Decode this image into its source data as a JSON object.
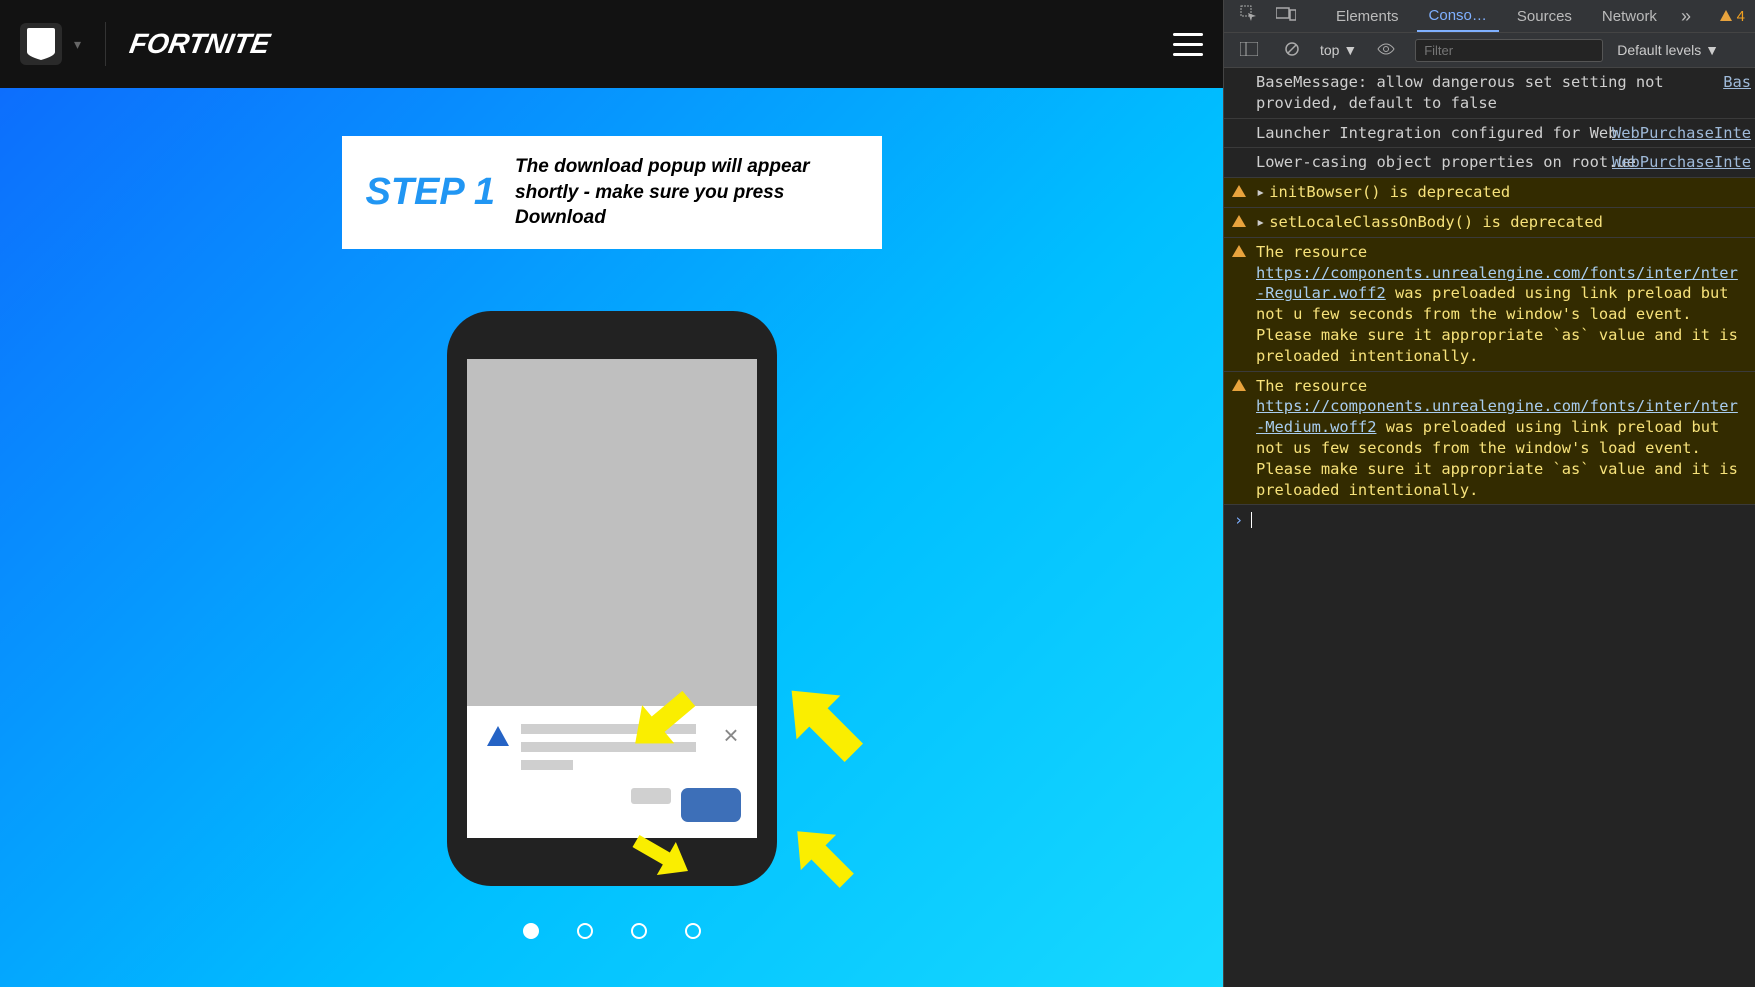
{
  "header": {
    "brand": "FORTNITE"
  },
  "step": {
    "label": "STEP 1",
    "description": "The download popup will appear shortly - make sure you press Download"
  },
  "dots": {
    "count": 4,
    "active": 0
  },
  "devtools": {
    "tabs": {
      "elements": "Elements",
      "console": "Conso…",
      "sources": "Sources",
      "network": "Network"
    },
    "warn_count": "4",
    "toolbar": {
      "context": "top",
      "filter_placeholder": "Filter",
      "levels": "Default levels"
    },
    "logs": [
      {
        "type": "log",
        "text": "BaseMessage: allow dangerous set setting not provided, default to false",
        "src": "Bas"
      },
      {
        "type": "log",
        "text": "Launcher Integration configured for Web",
        "src": "WebPurchaseInte"
      },
      {
        "type": "log",
        "text": "Lower-casing object properties on root.ue",
        "src": "WebPurchaseInte"
      },
      {
        "type": "warn",
        "text": "initBowser() is deprecated",
        "expand": true
      },
      {
        "type": "warn",
        "text": "setLocaleClassOnBody() is deprecated",
        "expand": true
      },
      {
        "type": "warn",
        "pre": "The resource ",
        "link": "https://components.unrealengine.com/fonts/inter/",
        "link_break": "nter-Regular.woff2",
        "post": " was preloaded using link preload but not u few seconds from the window's load event. Please make sure it appropriate `as` value and it is preloaded intentionally."
      },
      {
        "type": "warn",
        "pre": "The resource ",
        "link": "https://components.unrealengine.com/fonts/inter/",
        "link_break": "nter-Medium.woff2",
        "post": " was preloaded using link preload but not us few seconds from the window's load event. Please make sure it appropriate `as` value and it is preloaded intentionally."
      }
    ]
  }
}
